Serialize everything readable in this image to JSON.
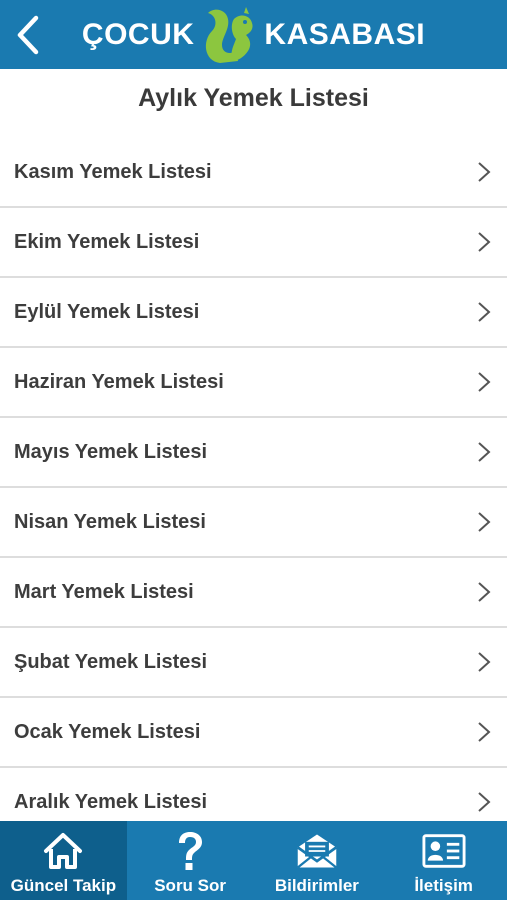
{
  "header": {
    "brand_left": "ÇOCUK",
    "brand_right": "KASABASI",
    "icons": {
      "back": "chevron-left-icon",
      "logo": "squirrel-logo-icon"
    },
    "colors": {
      "bar": "#1a7ab0",
      "logo": "#8cc63f"
    }
  },
  "page": {
    "title": "Aylık Yemek Listesi"
  },
  "list": {
    "items": [
      {
        "label": "Kasım Yemek Listesi"
      },
      {
        "label": "Ekim Yemek Listesi"
      },
      {
        "label": "Eylül Yemek Listesi"
      },
      {
        "label": "Haziran Yemek Listesi"
      },
      {
        "label": "Mayıs Yemek Listesi"
      },
      {
        "label": "Nisan Yemek Listesi"
      },
      {
        "label": "Mart Yemek Listesi"
      },
      {
        "label": "Şubat Yemek Listesi"
      },
      {
        "label": "Ocak Yemek Listesi"
      },
      {
        "label": "Aralık Yemek Listesi"
      }
    ]
  },
  "tabbar": {
    "active_color": "#0e5f8c",
    "tabs": [
      {
        "label": "Güncel Takip",
        "icon": "home-icon",
        "active": true
      },
      {
        "label": "Soru Sor",
        "icon": "question-mark-icon",
        "active": false
      },
      {
        "label": "Bildirimler",
        "icon": "envelope-icon",
        "active": false
      },
      {
        "label": "İletişim",
        "icon": "contact-card-icon",
        "active": false
      }
    ]
  }
}
